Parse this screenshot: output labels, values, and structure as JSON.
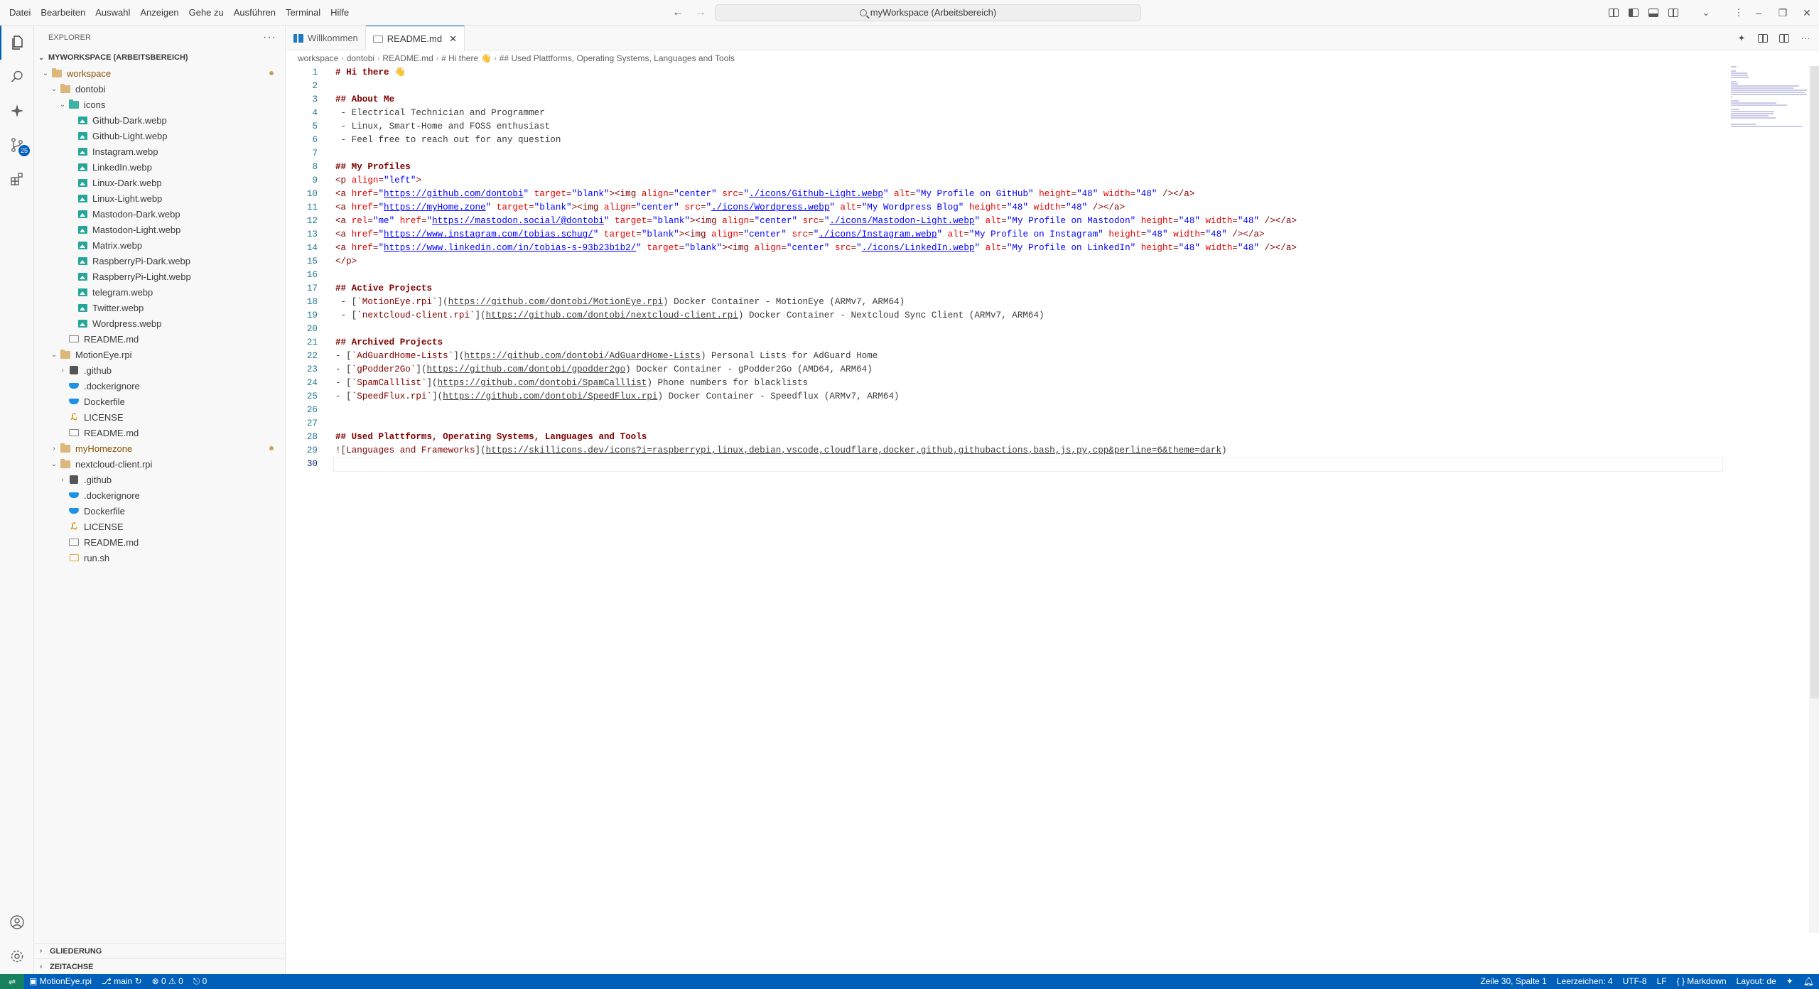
{
  "menu": [
    "Datei",
    "Bearbeiten",
    "Auswahl",
    "Anzeigen",
    "Gehe zu",
    "Ausführen",
    "Terminal",
    "Hilfe"
  ],
  "command_center": "myWorkspace (Arbeitsbereich)",
  "activity_bar": {
    "scm_badge": "25"
  },
  "sidebar": {
    "title": "EXPLORER",
    "workspace_title": "MYWORKSPACE (ARBEITSBEREICH)",
    "tree": [
      {
        "label": "workspace",
        "indent": 0,
        "type": "folder",
        "chev": "open",
        "modified": true
      },
      {
        "label": "dontobi",
        "indent": 1,
        "type": "folder",
        "chev": "open"
      },
      {
        "label": "icons",
        "indent": 2,
        "type": "folder-teal",
        "chev": "open"
      },
      {
        "label": "Github-Dark.webp",
        "indent": 3,
        "type": "img"
      },
      {
        "label": "Github-Light.webp",
        "indent": 3,
        "type": "img"
      },
      {
        "label": "Instagram.webp",
        "indent": 3,
        "type": "img"
      },
      {
        "label": "LinkedIn.webp",
        "indent": 3,
        "type": "img"
      },
      {
        "label": "Linux-Dark.webp",
        "indent": 3,
        "type": "img"
      },
      {
        "label": "Linux-Light.webp",
        "indent": 3,
        "type": "img"
      },
      {
        "label": "Mastodon-Dark.webp",
        "indent": 3,
        "type": "img"
      },
      {
        "label": "Mastodon-Light.webp",
        "indent": 3,
        "type": "img"
      },
      {
        "label": "Matrix.webp",
        "indent": 3,
        "type": "img"
      },
      {
        "label": "RaspberryPi-Dark.webp",
        "indent": 3,
        "type": "img"
      },
      {
        "label": "RaspberryPi-Light.webp",
        "indent": 3,
        "type": "img"
      },
      {
        "label": "telegram.webp",
        "indent": 3,
        "type": "img"
      },
      {
        "label": "Twitter.webp",
        "indent": 3,
        "type": "img"
      },
      {
        "label": "Wordpress.webp",
        "indent": 3,
        "type": "img"
      },
      {
        "label": "README.md",
        "indent": 2,
        "type": "md"
      },
      {
        "label": "MotionEye.rpi",
        "indent": 1,
        "type": "folder",
        "chev": "open"
      },
      {
        "label": ".github",
        "indent": 2,
        "type": "git",
        "chev": "closed"
      },
      {
        "label": ".dockerignore",
        "indent": 2,
        "type": "docker"
      },
      {
        "label": "Dockerfile",
        "indent": 2,
        "type": "docker"
      },
      {
        "label": "LICENSE",
        "indent": 2,
        "type": "license"
      },
      {
        "label": "README.md",
        "indent": 2,
        "type": "md"
      },
      {
        "label": "myHomezone",
        "indent": 1,
        "type": "folder",
        "chev": "closed",
        "modified": true
      },
      {
        "label": "nextcloud-client.rpi",
        "indent": 1,
        "type": "folder",
        "chev": "open"
      },
      {
        "label": ".github",
        "indent": 2,
        "type": "git",
        "chev": "closed"
      },
      {
        "label": ".dockerignore",
        "indent": 2,
        "type": "docker"
      },
      {
        "label": "Dockerfile",
        "indent": 2,
        "type": "docker"
      },
      {
        "label": "LICENSE",
        "indent": 2,
        "type": "license"
      },
      {
        "label": "README.md",
        "indent": 2,
        "type": "md"
      },
      {
        "label": "run.sh",
        "indent": 2,
        "type": "sh"
      }
    ],
    "outline_label": "GLIEDERUNG",
    "timeline_label": "ZEITACHSE"
  },
  "tabs": [
    {
      "label": "Willkommen",
      "active": false
    },
    {
      "label": "README.md",
      "active": true
    }
  ],
  "breadcrumbs": [
    "workspace",
    "dontobi",
    "README.md",
    "# Hi there 👋",
    "## Used Plattforms, Operating Systems, Languages and Tools"
  ],
  "editor": {
    "current_line": 30,
    "lines": [
      [
        [
          "h",
          "# Hi there 👋"
        ]
      ],
      [],
      [
        [
          "h",
          "## About Me"
        ]
      ],
      [
        [
          "t",
          " - Electrical Technician and Programmer"
        ]
      ],
      [
        [
          "t",
          " - Linux, Smart-Home and FOSS enthusiast"
        ]
      ],
      [
        [
          "t",
          " - Feel free to reach out for any question"
        ]
      ],
      [],
      [
        [
          "h",
          "## My Profiles"
        ]
      ],
      [
        [
          "g",
          "<p "
        ],
        [
          "a",
          "align"
        ],
        [
          "g",
          "="
        ],
        [
          "s",
          "\"left\""
        ],
        [
          "g",
          ">"
        ]
      ],
      [
        [
          "g",
          "<a "
        ],
        [
          "a",
          "href"
        ],
        [
          "g",
          "="
        ],
        [
          "s",
          "\""
        ],
        [
          "u",
          "https://github.com/dontobi"
        ],
        [
          "s",
          "\""
        ],
        [
          "a",
          " target"
        ],
        [
          "g",
          "="
        ],
        [
          "s",
          "\"blank\""
        ],
        [
          "g",
          "><img "
        ],
        [
          "a",
          "align"
        ],
        [
          "g",
          "="
        ],
        [
          "s",
          "\"center\""
        ],
        [
          "a",
          " src"
        ],
        [
          "g",
          "="
        ],
        [
          "s",
          "\""
        ],
        [
          "u",
          "./icons/Github-Light.webp"
        ],
        [
          "s",
          "\""
        ],
        [
          "a",
          " alt"
        ],
        [
          "g",
          "="
        ],
        [
          "s",
          "\"My Profile on GitHub\""
        ],
        [
          "a",
          " height"
        ],
        [
          "g",
          "="
        ],
        [
          "s",
          "\"48\""
        ],
        [
          "a",
          " width"
        ],
        [
          "g",
          "="
        ],
        [
          "s",
          "\"48\""
        ],
        [
          "g",
          " /></a>"
        ]
      ],
      [
        [
          "g",
          "<a "
        ],
        [
          "a",
          "href"
        ],
        [
          "g",
          "="
        ],
        [
          "s",
          "\""
        ],
        [
          "u",
          "https://myHome.zone"
        ],
        [
          "s",
          "\""
        ],
        [
          "a",
          " target"
        ],
        [
          "g",
          "="
        ],
        [
          "s",
          "\"blank\""
        ],
        [
          "g",
          "><img "
        ],
        [
          "a",
          "align"
        ],
        [
          "g",
          "="
        ],
        [
          "s",
          "\"center\""
        ],
        [
          "a",
          " src"
        ],
        [
          "g",
          "="
        ],
        [
          "s",
          "\""
        ],
        [
          "u",
          "./icons/Wordpress.webp"
        ],
        [
          "s",
          "\""
        ],
        [
          "a",
          " alt"
        ],
        [
          "g",
          "="
        ],
        [
          "s",
          "\"My Wordpress Blog\""
        ],
        [
          "a",
          " height"
        ],
        [
          "g",
          "="
        ],
        [
          "s",
          "\"48\""
        ],
        [
          "a",
          " width"
        ],
        [
          "g",
          "="
        ],
        [
          "s",
          "\"48\""
        ],
        [
          "g",
          " /></a>"
        ]
      ],
      [
        [
          "g",
          "<a "
        ],
        [
          "a",
          "rel"
        ],
        [
          "g",
          "="
        ],
        [
          "s",
          "\"me\""
        ],
        [
          "a",
          " href"
        ],
        [
          "g",
          "="
        ],
        [
          "s",
          "\""
        ],
        [
          "u",
          "https://mastodon.social/@dontobi"
        ],
        [
          "s",
          "\""
        ],
        [
          "a",
          " target"
        ],
        [
          "g",
          "="
        ],
        [
          "s",
          "\"blank\""
        ],
        [
          "g",
          "><img "
        ],
        [
          "a",
          "align"
        ],
        [
          "g",
          "="
        ],
        [
          "s",
          "\"center\""
        ],
        [
          "a",
          " src"
        ],
        [
          "g",
          "="
        ],
        [
          "s",
          "\""
        ],
        [
          "u",
          "./icons/Mastodon-Light.webp"
        ],
        [
          "s",
          "\""
        ],
        [
          "a",
          " alt"
        ],
        [
          "g",
          "="
        ],
        [
          "s",
          "\"My Profile on Mastodon\""
        ],
        [
          "a",
          " height"
        ],
        [
          "g",
          "="
        ],
        [
          "s",
          "\"48\""
        ],
        [
          "a",
          " width"
        ],
        [
          "g",
          "="
        ],
        [
          "s",
          "\"48\""
        ],
        [
          "g",
          " /></a>"
        ]
      ],
      [
        [
          "g",
          "<a "
        ],
        [
          "a",
          "href"
        ],
        [
          "g",
          "="
        ],
        [
          "s",
          "\""
        ],
        [
          "u",
          "https://www.instagram.com/tobias.schug/"
        ],
        [
          "s",
          "\""
        ],
        [
          "a",
          " target"
        ],
        [
          "g",
          "="
        ],
        [
          "s",
          "\"blank\""
        ],
        [
          "g",
          "><img "
        ],
        [
          "a",
          "align"
        ],
        [
          "g",
          "="
        ],
        [
          "s",
          "\"center\""
        ],
        [
          "a",
          " src"
        ],
        [
          "g",
          "="
        ],
        [
          "s",
          "\""
        ],
        [
          "u",
          "./icons/Instagram.webp"
        ],
        [
          "s",
          "\""
        ],
        [
          "a",
          " alt"
        ],
        [
          "g",
          "="
        ],
        [
          "s",
          "\"My Profile on Instagram\""
        ],
        [
          "a",
          " height"
        ],
        [
          "g",
          "="
        ],
        [
          "s",
          "\"48\""
        ],
        [
          "a",
          " width"
        ],
        [
          "g",
          "="
        ],
        [
          "s",
          "\"48\""
        ],
        [
          "g",
          " /></a>"
        ]
      ],
      [
        [
          "g",
          "<a "
        ],
        [
          "a",
          "href"
        ],
        [
          "g",
          "="
        ],
        [
          "s",
          "\""
        ],
        [
          "u",
          "https://www.linkedin.com/in/tobias-s-93b23b1b2/"
        ],
        [
          "s",
          "\""
        ],
        [
          "a",
          " target"
        ],
        [
          "g",
          "="
        ],
        [
          "s",
          "\"blank\""
        ],
        [
          "g",
          "><img "
        ],
        [
          "a",
          "align"
        ],
        [
          "g",
          "="
        ],
        [
          "s",
          "\"center\""
        ],
        [
          "a",
          " src"
        ],
        [
          "g",
          "="
        ],
        [
          "s",
          "\""
        ],
        [
          "u",
          "./icons/LinkedIn.webp"
        ],
        [
          "s",
          "\""
        ],
        [
          "a",
          " alt"
        ],
        [
          "g",
          "="
        ],
        [
          "s",
          "\"My Profile on LinkedIn\""
        ],
        [
          "a",
          " height"
        ],
        [
          "g",
          "="
        ],
        [
          "s",
          "\"48\""
        ],
        [
          "a",
          " width"
        ],
        [
          "g",
          "="
        ],
        [
          "s",
          "\"48\""
        ],
        [
          "g",
          " /></a>"
        ]
      ],
      [
        [
          "g",
          "</p>"
        ]
      ],
      [],
      [
        [
          "h",
          "## Active Projects"
        ]
      ],
      [
        [
          "t",
          " - ["
        ],
        [
          "g",
          "`MotionEye.rpi`"
        ],
        [
          "t",
          "]("
        ],
        [
          "tu",
          "https://github.com/dontobi/MotionEye.rpi"
        ],
        [
          "t",
          ") Docker Container - MotionEye (ARMv7, ARM64)"
        ]
      ],
      [
        [
          "t",
          " - ["
        ],
        [
          "g",
          "`nextcloud-client.rpi`"
        ],
        [
          "t",
          "]("
        ],
        [
          "tu",
          "https://github.com/dontobi/nextcloud-client.rpi"
        ],
        [
          "t",
          ") Docker Container - Nextcloud Sync Client (ARMv7, ARM64)"
        ]
      ],
      [],
      [
        [
          "h",
          "## Archived Projects"
        ]
      ],
      [
        [
          "t",
          "- ["
        ],
        [
          "g",
          "`AdGuardHome-Lists`"
        ],
        [
          "t",
          "]("
        ],
        [
          "tu",
          "https://github.com/dontobi/AdGuardHome-Lists"
        ],
        [
          "t",
          ") Personal Lists for AdGuard Home"
        ]
      ],
      [
        [
          "t",
          "- ["
        ],
        [
          "g",
          "`gPodder2Go`"
        ],
        [
          "t",
          "]("
        ],
        [
          "tu",
          "https://github.com/dontobi/gpodder2go"
        ],
        [
          "t",
          ") Docker Container - gPodder2Go (AMD64, ARM64)"
        ]
      ],
      [
        [
          "t",
          "- ["
        ],
        [
          "g",
          "`SpamCalllist`"
        ],
        [
          "t",
          "]("
        ],
        [
          "tu",
          "https://github.com/dontobi/SpamCalllist"
        ],
        [
          "t",
          ") Phone numbers for blacklists"
        ]
      ],
      [
        [
          "t",
          "- ["
        ],
        [
          "g",
          "`SpeedFlux.rpi`"
        ],
        [
          "t",
          "]("
        ],
        [
          "tu",
          "https://github.com/dontobi/SpeedFlux.rpi"
        ],
        [
          "t",
          ") Docker Container - Speedflux (ARMv7, ARM64)"
        ]
      ],
      [],
      [],
      [
        [
          "h",
          "## Used Plattforms, Operating Systems, Languages and Tools"
        ]
      ],
      [
        [
          "t",
          "!["
        ],
        [
          "g",
          "Languages and Frameworks"
        ],
        [
          "t",
          "]("
        ],
        [
          "tu",
          "https://skillicons.dev/icons?i=raspberrypi,linux,debian,vscode,cloudflare,docker,github,githubactions,bash,js,py,cpp&perline=6&theme=dark"
        ],
        [
          "t",
          ")"
        ]
      ],
      []
    ]
  },
  "statusbar": {
    "repo": "MotionEye.rpi",
    "branch": "main",
    "problems": "0",
    "warnings": "0",
    "ports": "0",
    "position": "Zeile 30, Spalte 1",
    "indent": "Leerzeichen: 4",
    "encoding": "UTF-8",
    "eol": "LF",
    "language": "Markdown",
    "layout": "Layout: de"
  },
  "colors": {
    "accent": "#005fb8",
    "remote": "#16825d",
    "heading": "#800000",
    "attribute": "#e50000",
    "string": "#0000ff",
    "line_number": "#237893"
  }
}
